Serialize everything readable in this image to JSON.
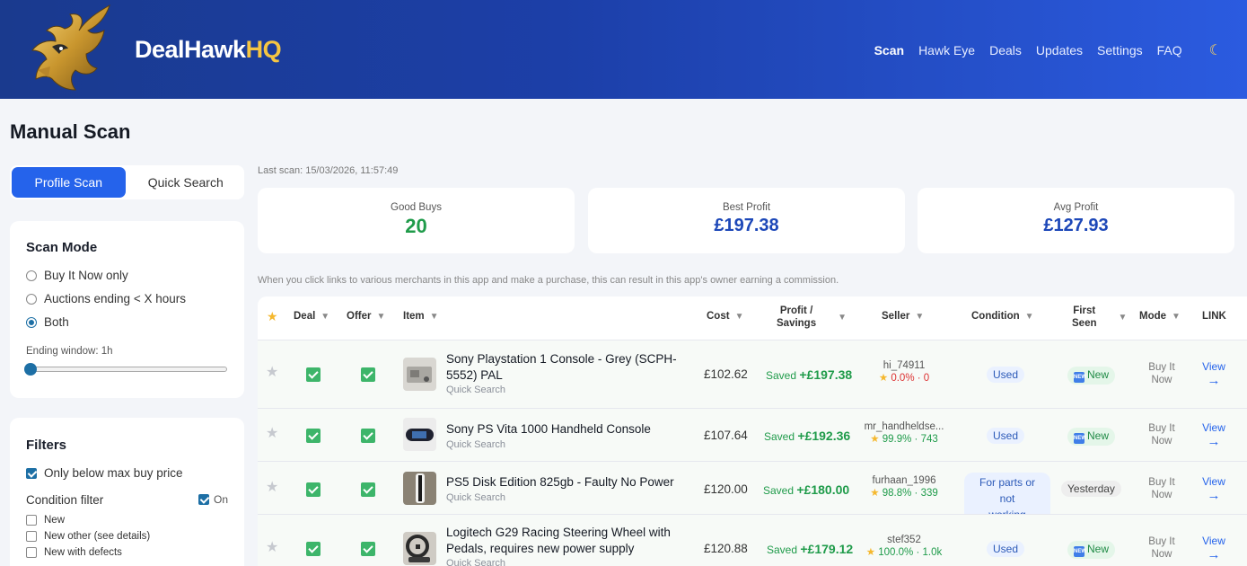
{
  "app": {
    "brand_main": "DealHawk",
    "brand_accent": "HQ"
  },
  "nav": {
    "items": [
      "Scan",
      "Hawk Eye",
      "Deals",
      "Updates",
      "Settings",
      "FAQ"
    ],
    "active": "Scan",
    "theme_icon": "moon-icon"
  },
  "page": {
    "title": "Manual Scan"
  },
  "tabs": {
    "profile": "Profile Scan",
    "quick": "Quick Search",
    "active": "Profile Scan"
  },
  "scan_mode": {
    "title": "Scan Mode",
    "options": [
      "Buy It Now only",
      "Auctions ending < X hours",
      "Both"
    ],
    "selected": "Both",
    "ending_window_label": "Ending window: 1h",
    "ending_window_fraction": 0.0
  },
  "filters": {
    "title": "Filters",
    "below_max": "Only below max buy price",
    "condition_label": "Condition filter",
    "condition_toggle": "On",
    "conditions": [
      "New",
      "New other (see details)",
      "New with defects"
    ]
  },
  "summary": {
    "last_scan": "Last scan: 15/03/2026, 11:57:49",
    "stats": [
      {
        "label": "Good Buys",
        "value": "20",
        "color": "#1f9b4a"
      },
      {
        "label": "Best Profit",
        "value": "£197.38",
        "color": "#1c47b8"
      },
      {
        "label": "Avg Profit",
        "value": "£127.93",
        "color": "#1c47b8"
      }
    ],
    "disclaimer": "When you click links to various merchants in this app and make a purchase, this can result in this app's owner earning a commission."
  },
  "table": {
    "headers": {
      "deal": "Deal",
      "offer": "Offer",
      "item": "Item",
      "cost": "Cost",
      "profit_1": "Profit /",
      "profit_2": "Savings",
      "seller": "Seller",
      "condition": "Condition",
      "first_1": "First",
      "first_2": "Seen",
      "mode": "Mode",
      "link": "LINK"
    },
    "rows": [
      {
        "title_1": "Sony Playstation 1 Console - Grey (SCPH-",
        "title_2": "5552) PAL",
        "source": "Quick Search",
        "cost": "£102.62",
        "saved": "Saved",
        "profit": "+£197.38",
        "seller": "hi_74911",
        "seller_stat": "0.0% · 0",
        "condition": "Used",
        "first_seen": "New",
        "mode_1": "Buy It",
        "mode_2": "Now",
        "view": "View",
        "arrow": "→"
      },
      {
        "title_1": "Sony PS Vita 1000 Handheld Console",
        "title_2": "",
        "source": "Quick Search",
        "cost": "£107.64",
        "saved": "Saved",
        "profit": "+£192.36",
        "seller": "mr_handheldse...",
        "seller_stat": "99.9% · 743",
        "condition": "Used",
        "first_seen": "New",
        "mode_1": "Buy It",
        "mode_2": "Now",
        "view": "View",
        "arrow": "→"
      },
      {
        "title_1": "PS5 Disk Edition 825gb - Faulty No Power",
        "title_2": "",
        "source": "Quick Search",
        "cost": "£120.00",
        "saved": "Saved",
        "profit": "+£180.00",
        "seller": "furhaan_1996",
        "seller_stat": "98.8% · 339",
        "condition_1": "For parts or not",
        "condition_2": "working",
        "first_seen": "Yesterday",
        "mode_1": "Buy It",
        "mode_2": "Now",
        "view": "View",
        "arrow": "→"
      },
      {
        "title_1": "Logitech G29 Racing Steering Wheel with",
        "title_2": "Pedals, requires new power supply",
        "source": "Quick Search",
        "cost": "£120.88",
        "saved": "Saved",
        "profit": "+£179.12",
        "seller": "stef352",
        "seller_stat": "100.0% · 1.0k",
        "condition": "Used",
        "first_seen": "New",
        "mode_1": "Buy It",
        "mode_2": "Now",
        "view": "View",
        "arrow": "→"
      }
    ]
  },
  "colors": {
    "accent": "#2563eb",
    "profit": "#1f9b4a",
    "header_start": "#1a3a8e",
    "header_end": "#2b5be0"
  }
}
